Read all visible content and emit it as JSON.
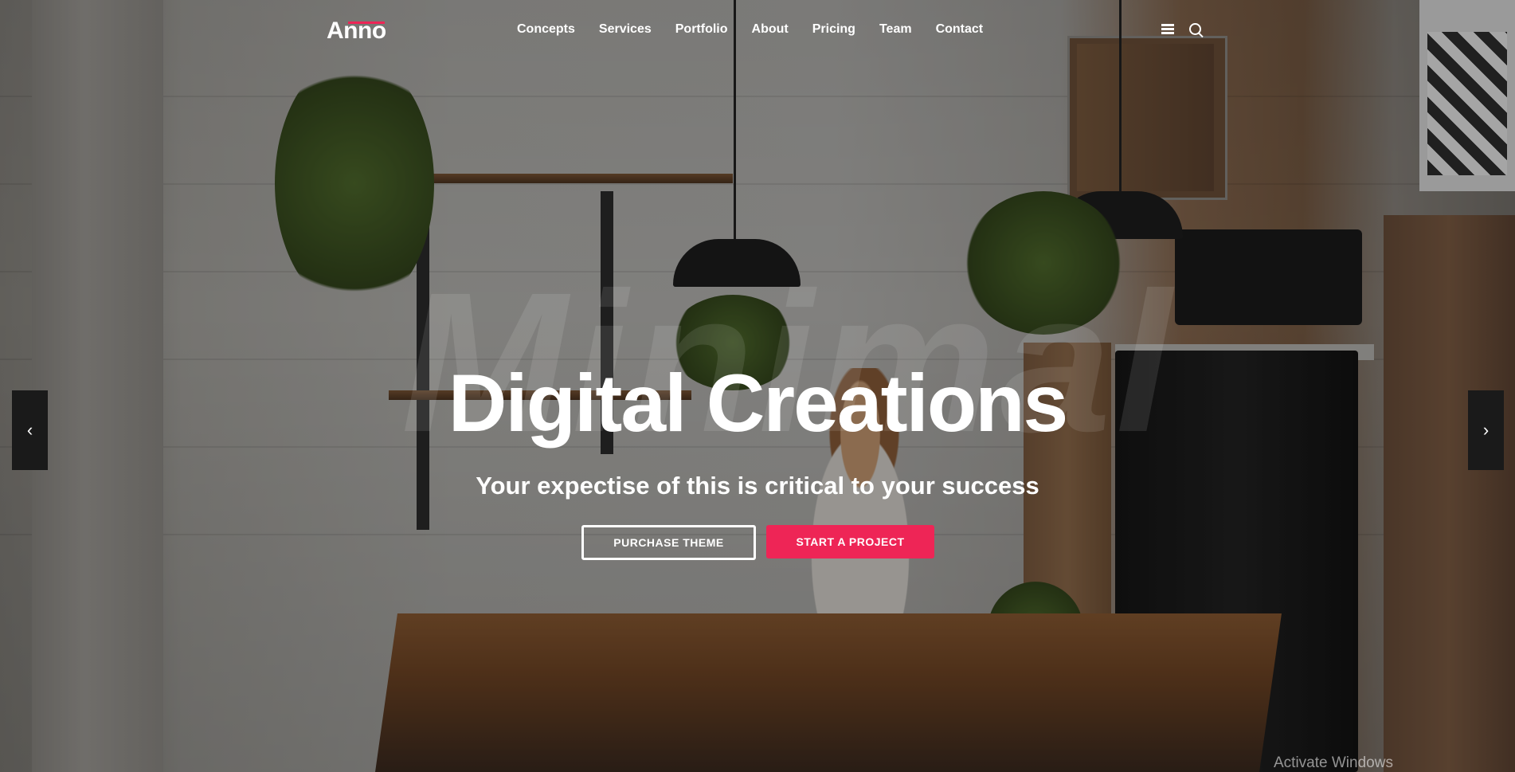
{
  "brand": {
    "logo_text": "Anno",
    "accent_color": "#ee2556"
  },
  "nav": {
    "items": [
      {
        "label": "Concepts"
      },
      {
        "label": "Services"
      },
      {
        "label": "Portfolio"
      },
      {
        "label": "About"
      },
      {
        "label": "Pricing"
      },
      {
        "label": "Team"
      },
      {
        "label": "Contact"
      }
    ],
    "icons": {
      "menu": "hamburger-icon",
      "search": "search-icon"
    }
  },
  "hero": {
    "watermark": "Minimal",
    "title": "Digital Creations",
    "subtitle": "Your expectise of this is critical to your success",
    "buttons": {
      "secondary": "PURCHASE THEME",
      "primary": "START A PROJECT"
    },
    "prev_arrow": "‹",
    "next_arrow": "›"
  },
  "system": {
    "activate_text": "Activate Windows"
  }
}
